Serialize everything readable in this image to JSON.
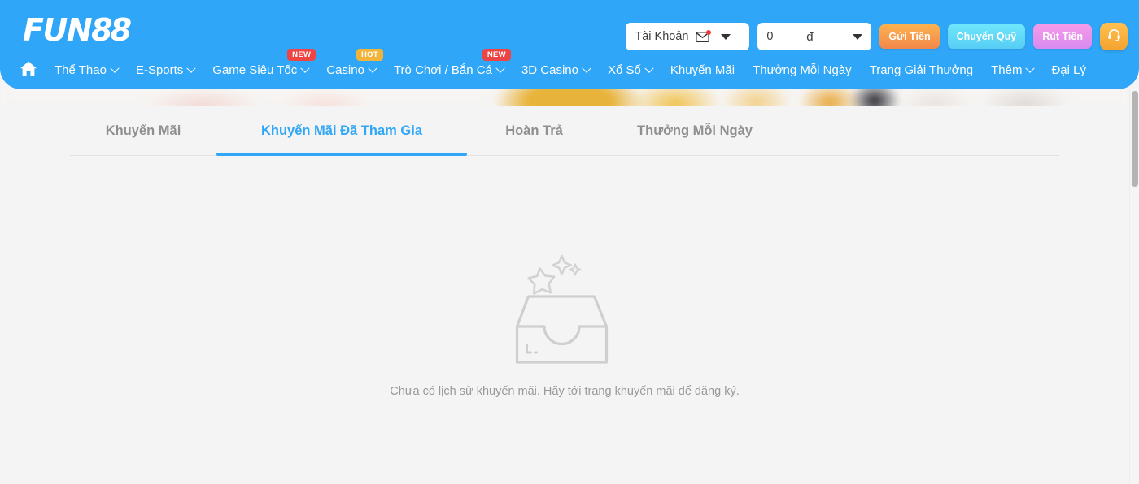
{
  "brand": {
    "logo_text": "FUN",
    "logo_number": "88",
    "accent_color": "#2fa6f7"
  },
  "header": {
    "account": {
      "label": "Tài Khoản",
      "mail_icon": "envelope-icon",
      "has_unread": true,
      "caret_icon": "caret-down-icon"
    },
    "balance": {
      "value": "0",
      "currency": "đ",
      "caret_icon": "caret-down-icon"
    },
    "buttons": [
      {
        "label": "Gửi Tiền",
        "name": "deposit-button",
        "color": "#f7993f"
      },
      {
        "label": "Chuyển Quỹ",
        "name": "transfer-button",
        "color": "#5fd6f7"
      },
      {
        "label": "Rút Tiền",
        "name": "withdraw-button",
        "color": "#e391ec"
      }
    ],
    "support_icon": "headset-icon"
  },
  "nav": {
    "home_icon": "home-icon",
    "items": [
      {
        "label": "Thể Thao",
        "has_caret": true,
        "badge": null
      },
      {
        "label": "E-Sports",
        "has_caret": true,
        "badge": null
      },
      {
        "label": "Game Siêu Tốc",
        "has_caret": true,
        "badge": "NEW",
        "badge_type": "new"
      },
      {
        "label": "Casino",
        "has_caret": true,
        "badge": "HOT",
        "badge_type": "hot"
      },
      {
        "label": "Trò Chơi / Bắn Cá",
        "has_caret": true,
        "badge": "NEW",
        "badge_type": "new"
      },
      {
        "label": "3D Casino",
        "has_caret": true,
        "badge": null
      },
      {
        "label": "Xổ Số",
        "has_caret": true,
        "badge": null
      },
      {
        "label": "Khuyến Mãi",
        "has_caret": false,
        "badge": null
      },
      {
        "label": "Thưởng Mỗi Ngày",
        "has_caret": false,
        "badge": null
      },
      {
        "label": "Trang Giải Thưởng",
        "has_caret": false,
        "badge": null
      },
      {
        "label": "Thêm",
        "has_caret": true,
        "badge": null
      },
      {
        "label": "Đại Lý",
        "has_caret": false,
        "badge": null
      }
    ]
  },
  "tabs": [
    {
      "label": "Khuyến Mãi",
      "active": false
    },
    {
      "label": "Khuyến Mãi Đã Tham Gia",
      "active": true
    },
    {
      "label": "Hoàn Trả",
      "active": false
    },
    {
      "label": "Thưởng Mỗi Ngày",
      "active": false
    }
  ],
  "empty_state": {
    "icon": "empty-box-with-stars-icon",
    "message": "Chưa có lịch sử khuyến mãi. Hãy tới trang khuyến mãi để đăng ký."
  },
  "scrollbar": {
    "name": "vertical-scrollbar"
  }
}
